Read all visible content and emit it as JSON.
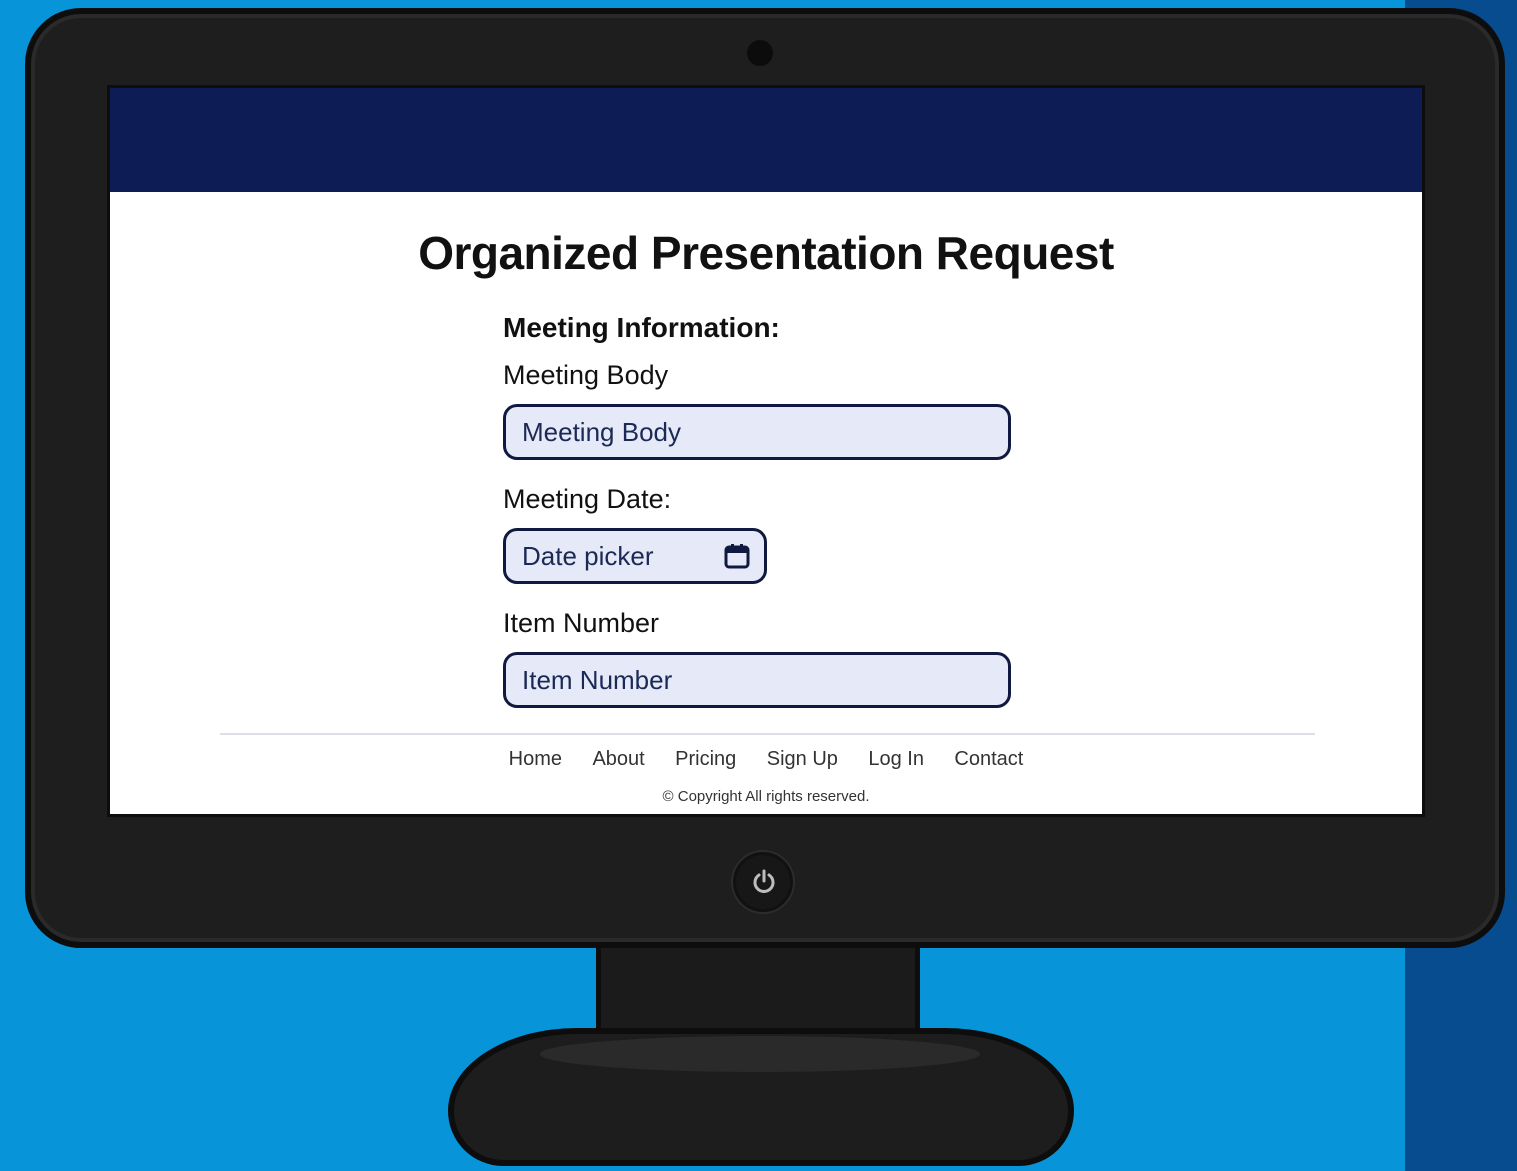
{
  "page": {
    "title": "Organized Presentation Request"
  },
  "form": {
    "section_title": "Meeting Information:",
    "meeting_body": {
      "label": "Meeting Body",
      "placeholder": "Meeting Body"
    },
    "meeting_date": {
      "label": "Meeting Date:",
      "placeholder": "Date picker",
      "icon": "calendar-icon"
    },
    "item_number": {
      "label": "Item Number",
      "placeholder": "Item Number"
    }
  },
  "footer": {
    "links": [
      "Home",
      "About",
      "Pricing",
      "Sign Up",
      "Log In",
      "Contact"
    ],
    "copyright": "© Copyright All rights reserved."
  },
  "colors": {
    "header": "#0d1c54",
    "input_fill": "#e6e9f7",
    "input_border": "#101a40",
    "background": "#0894d8"
  }
}
